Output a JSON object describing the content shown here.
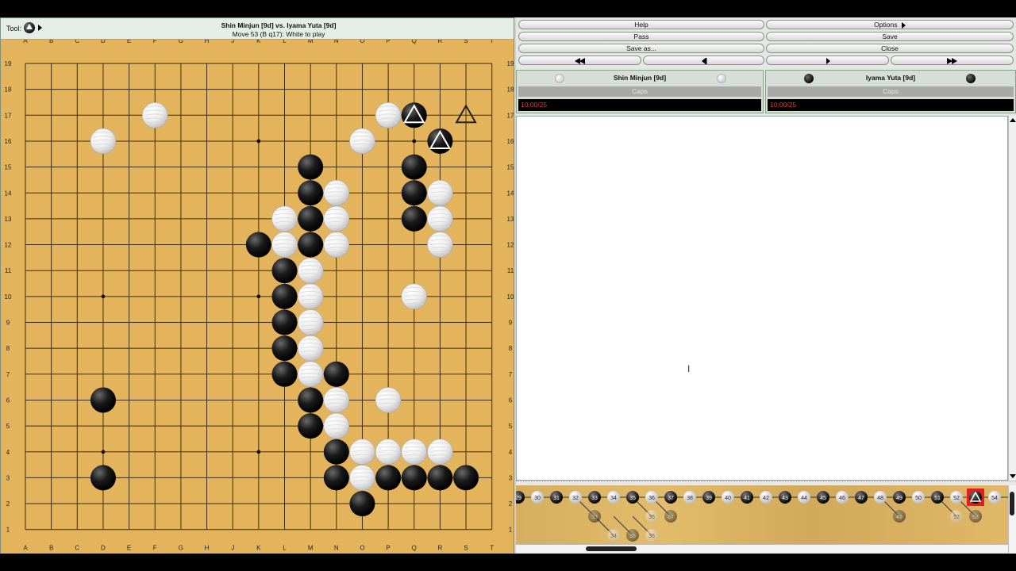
{
  "toolbar": {
    "tool_label": "Tool:",
    "current_tool_icon": "black-stone-triangle-icon"
  },
  "game": {
    "title": "Shin Minjun [9d] vs. Iyama Yuta [9d]",
    "status": "Move 53 (B q17): White to play"
  },
  "board": {
    "size": 19,
    "columns": [
      "A",
      "B",
      "C",
      "D",
      "E",
      "F",
      "G",
      "H",
      "J",
      "K",
      "L",
      "M",
      "N",
      "O",
      "P",
      "Q",
      "R",
      "S",
      "T"
    ],
    "rows": [
      "19",
      "18",
      "17",
      "16",
      "15",
      "14",
      "13",
      "12",
      "11",
      "10",
      "9",
      "8",
      "7",
      "6",
      "5",
      "4",
      "3",
      "2",
      "1"
    ],
    "colors": {
      "wood": "#e4b45d",
      "line": "#3a2a14",
      "triangle": "#222222"
    },
    "stones": {
      "black": [
        "Q17",
        "R16",
        "M15",
        "Q15",
        "M14",
        "Q14",
        "M13",
        "Q13",
        "K12",
        "M12",
        "L11",
        "L10",
        "L9",
        "L8",
        "L7",
        "N7",
        "D6",
        "M6",
        "M5",
        "N4",
        "D3",
        "N3",
        "P3",
        "Q3",
        "R3",
        "S3",
        "O2"
      ],
      "white": [
        "P17",
        "F17",
        "D16",
        "O16",
        "N14",
        "R14",
        "L13",
        "N13",
        "R13",
        "L12",
        "N12",
        "R12",
        "M11",
        "M10",
        "Q10",
        "M9",
        "M8",
        "M7",
        "N6",
        "P6",
        "N5",
        "O4",
        "P4",
        "Q4",
        "R4",
        "O3"
      ]
    },
    "markers": [
      {
        "point": "Q17",
        "type": "triangle",
        "label": "last-move"
      },
      {
        "point": "R16",
        "type": "triangle",
        "label": "marked"
      },
      {
        "point": "S17",
        "type": "triangle",
        "label": "marked-empty"
      }
    ]
  },
  "buttons": {
    "help": "Help",
    "options": "Options",
    "pass": "Pass",
    "save": "Save",
    "save_as": "Save as...",
    "close": "Close"
  },
  "players": {
    "white": {
      "name": "Shin Minjun [9d]",
      "caps_label": "Caps",
      "clock": "10:00/25"
    },
    "black": {
      "name": "Iyama Yuta [9d]",
      "caps_label": "Caps",
      "clock": "10:00/25"
    }
  },
  "tree": {
    "main_line": [
      {
        "n": "29",
        "c": "b"
      },
      {
        "n": "30",
        "c": "w"
      },
      {
        "n": "31",
        "c": "b"
      },
      {
        "n": "32",
        "c": "w"
      },
      {
        "n": "33",
        "c": "b"
      },
      {
        "n": "34",
        "c": "w"
      },
      {
        "n": "35",
        "c": "b"
      },
      {
        "n": "36",
        "c": "w"
      },
      {
        "n": "37",
        "c": "b"
      },
      {
        "n": "38",
        "c": "w"
      },
      {
        "n": "39",
        "c": "b"
      },
      {
        "n": "40",
        "c": "w"
      },
      {
        "n": "41",
        "c": "b"
      },
      {
        "n": "42",
        "c": "w"
      },
      {
        "n": "43",
        "c": "b"
      },
      {
        "n": "44",
        "c": "w"
      },
      {
        "n": "45",
        "c": "b"
      },
      {
        "n": "46",
        "c": "w"
      },
      {
        "n": "47",
        "c": "b"
      },
      {
        "n": "48",
        "c": "w"
      },
      {
        "n": "49",
        "c": "b"
      },
      {
        "n": "50",
        "c": "w"
      },
      {
        "n": "51",
        "c": "b"
      },
      {
        "n": "52",
        "c": "w"
      },
      {
        "n": "53",
        "c": "b",
        "current": true
      },
      {
        "n": "54",
        "c": "w"
      }
    ],
    "variations": [
      {
        "from": "32",
        "n": "33",
        "c": "b",
        "row": 1,
        "col": 4
      },
      {
        "from": "36",
        "n": "36",
        "c": "w",
        "row": 1,
        "col": 7
      },
      {
        "from": "36",
        "n": "37",
        "c": "b",
        "row": 1,
        "col": 8
      },
      {
        "from": "33",
        "n": "34",
        "c": "w",
        "row": 2,
        "col": 5
      },
      {
        "from": "33",
        "n": "35",
        "c": "b",
        "row": 2,
        "col": 6
      },
      {
        "from": "33",
        "n": "36",
        "c": "w",
        "row": 2,
        "col": 7
      },
      {
        "from": "48",
        "n": "49",
        "c": "b",
        "row": 1,
        "col": 20
      },
      {
        "from": "51",
        "n": "52",
        "c": "w",
        "row": 1,
        "col": 23
      },
      {
        "from": "51",
        "n": "53",
        "c": "b",
        "row": 1,
        "col": 24
      }
    ]
  }
}
